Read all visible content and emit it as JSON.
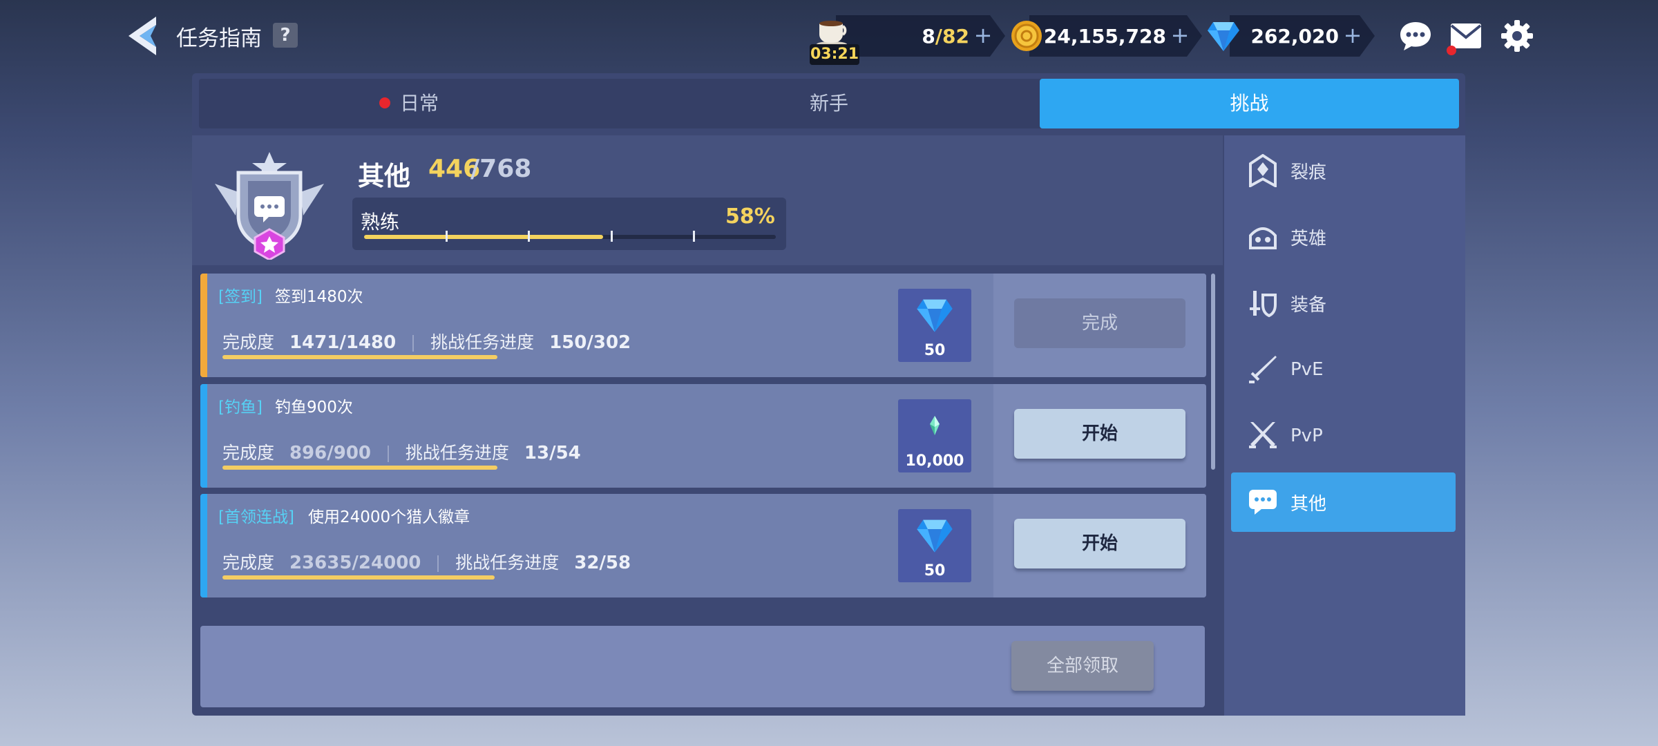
{
  "header": {
    "title": "任务指南",
    "help_label": "?"
  },
  "resources": {
    "stamina": {
      "current": "8",
      "separator": "/",
      "max": "82",
      "timer": "03:21"
    },
    "gold": "24,155,728",
    "gems": "262,020",
    "plus_label": "+"
  },
  "tabs": [
    {
      "label": "日常",
      "has_alert": true
    },
    {
      "label": "新手"
    },
    {
      "label": "挑战",
      "active": true
    }
  ],
  "category": {
    "title": "其他",
    "score_current": "446",
    "score_total": "/768",
    "mastery_label": "熟练",
    "mastery_percent": "58%",
    "mastery_fraction": 0.58
  },
  "sidebar": {
    "items": [
      {
        "label": "裂痕",
        "icon": "rift-icon"
      },
      {
        "label": "英雄",
        "icon": "hero-icon"
      },
      {
        "label": "装备",
        "icon": "equipment-icon"
      },
      {
        "label": "PvE",
        "icon": "sword-icon"
      },
      {
        "label": "PvP",
        "icon": "crossed-swords-icon"
      },
      {
        "label": "其他",
        "icon": "chat-bubble-icon",
        "active": true
      }
    ]
  },
  "quests": [
    {
      "category": "[签到]",
      "name": "签到1480次",
      "progress_label": "完成度",
      "progress_value": "1471/1480",
      "challenge_label": "挑战任务进度",
      "challenge_value": "150/302",
      "progress_fraction": 0.994,
      "reward_icon": "diamond-icon",
      "reward_value": "50",
      "button_label": "完成",
      "state": "done",
      "stripe_color": "#f2a93b"
    },
    {
      "category": "[钓鱼]",
      "name": "钓鱼900次",
      "progress_label": "完成度",
      "progress_value": "896/900",
      "challenge_label": "挑战任务进度",
      "challenge_value": "13/54",
      "progress_fraction": 0.996,
      "reward_icon": "crystal-icon",
      "reward_value": "10,000",
      "button_label": "开始",
      "state": "start",
      "stripe_color": "#2ea7f2"
    },
    {
      "category": "[首领连战]",
      "name": "使用24000个猎人徽章",
      "progress_label": "完成度",
      "progress_value": "23635/24000",
      "challenge_label": "挑战任务进度",
      "challenge_value": "32/58",
      "progress_fraction": 0.985,
      "reward_icon": "diamond-icon",
      "reward_value": "50",
      "button_label": "开始",
      "state": "start",
      "stripe_color": "#2ea7f2"
    }
  ],
  "footer": {
    "claim_all_label": "全部领取"
  },
  "colors": {
    "accent": "#2ea7f2",
    "gold_text": "#f4d35e",
    "alert": "#e8262d",
    "category_text": "#56d2f5"
  }
}
